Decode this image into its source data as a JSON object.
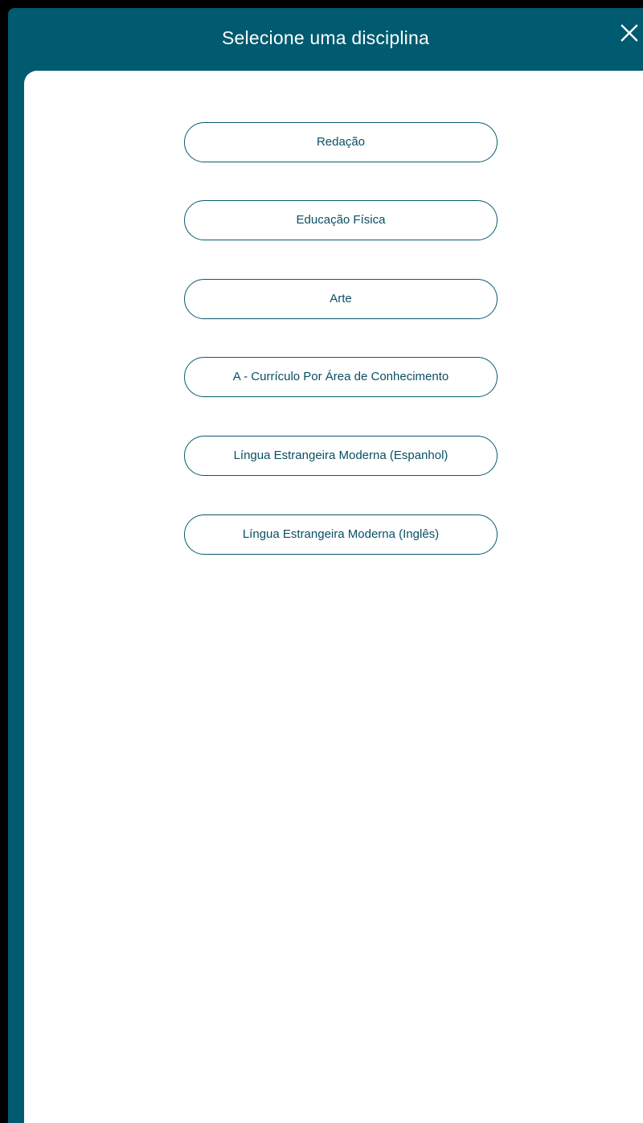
{
  "dialog": {
    "title": "Selecione uma disciplina",
    "close_icon": "close-icon",
    "colors": {
      "header_bg": "#005a70",
      "content_bg": "#ffffff",
      "button_border": "#0a5a6e",
      "button_text": "#0a4f63",
      "title_text": "#ffffff"
    }
  },
  "disciplines": [
    {
      "label": "Redação"
    },
    {
      "label": "Educação Física"
    },
    {
      "label": "Arte"
    },
    {
      "label": "A - Currículo Por Área de Conhecimento"
    },
    {
      "label": "Língua Estrangeira Moderna (Espanhol)"
    },
    {
      "label": "Língua Estrangeira Moderna (Inglês)"
    }
  ]
}
